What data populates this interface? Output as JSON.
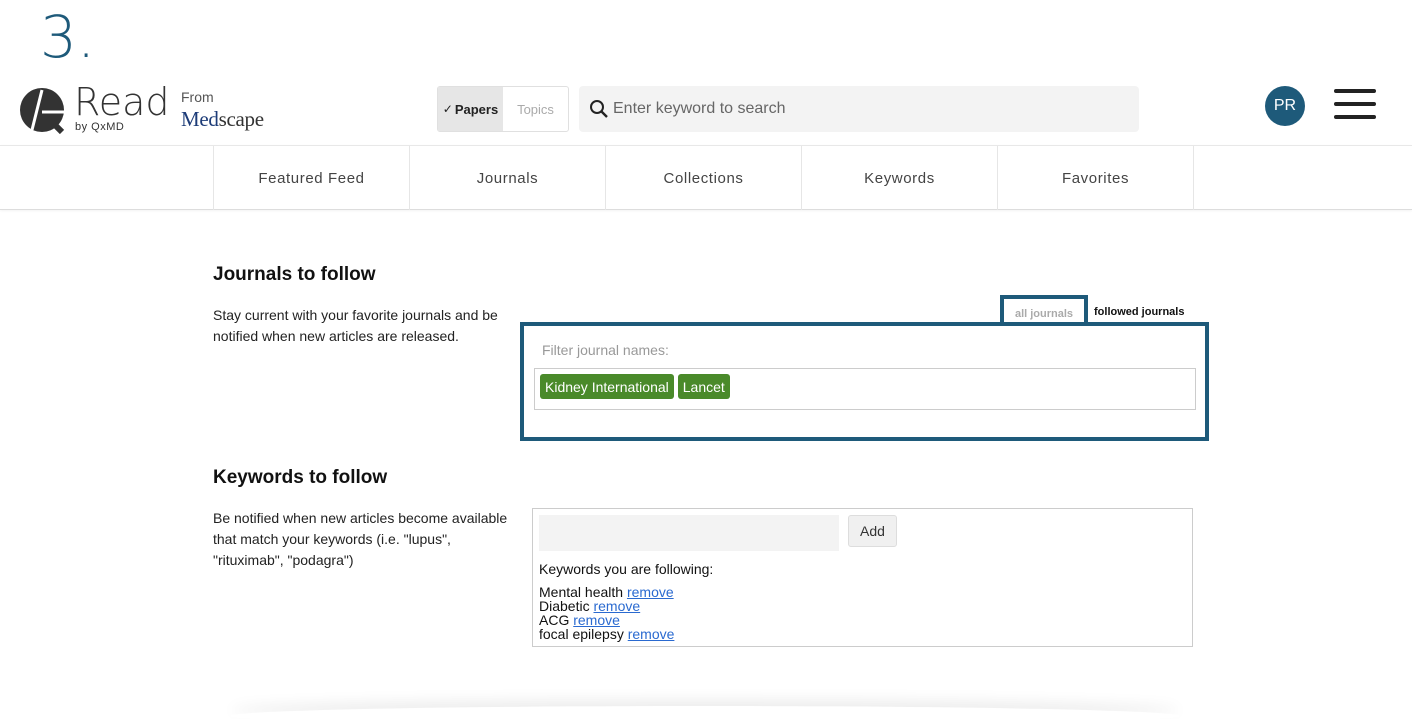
{
  "step_number": "3.",
  "header": {
    "logo_text": "Read",
    "logo_sub": "by QxMD",
    "from_label": "From",
    "medscape_med": "Med",
    "medscape_scape": "scape",
    "toggle": {
      "papers": "Papers",
      "topics": "Topics"
    },
    "search_placeholder": "Enter keyword to search",
    "avatar_initials": "PR"
  },
  "nav": {
    "items": [
      "Featured Feed",
      "Journals",
      "Collections",
      "Keywords",
      "Favorites"
    ]
  },
  "journals": {
    "title": "Journals to follow",
    "description": "Stay current with your favorite journals and be notified when new articles are released.",
    "tab_all": "all journals",
    "tab_followed": "followed journals",
    "filter_label": "Filter journal names:",
    "tags": [
      "Kidney International",
      "Lancet"
    ]
  },
  "keywords": {
    "title": "Keywords to follow",
    "description": "Be notified when new articles become available that match your keywords (i.e. \"lupus\", \"rituximab\", \"podagra\")",
    "add_label": "Add",
    "following_heading": "Keywords you are following:",
    "remove_label": "remove",
    "items": [
      "Mental health",
      "Diabetic",
      "ACG",
      "focal epilepsy"
    ]
  },
  "colors": {
    "brand_blue": "#1e5a7a",
    "tag_green": "#4a8a2a",
    "link_blue": "#2a6ad0"
  }
}
